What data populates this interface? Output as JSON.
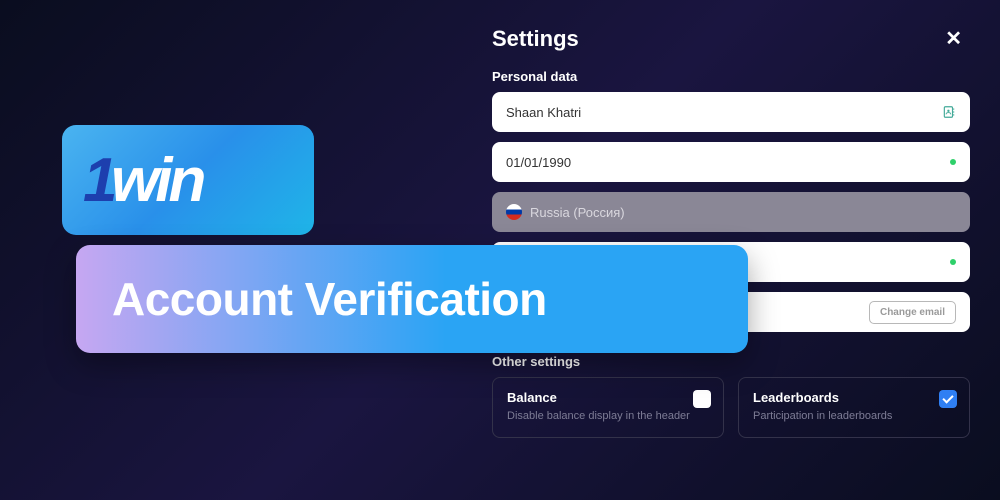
{
  "promo": {
    "logo_text": "1win",
    "title": "Account Verification"
  },
  "settings": {
    "title": "Settings",
    "personal_data_label": "Personal data",
    "name_value": "Shaan Khatri",
    "dob_value": "01/01/1990",
    "country_value": "Russia (Россия)",
    "phone_value": "",
    "email_value": "",
    "change_email_label": "Change email",
    "other_label": "Other settings",
    "balance_card": {
      "title": "Balance",
      "desc": "Disable balance display in the header",
      "checked": false
    },
    "leaderboards_card": {
      "title": "Leaderboards",
      "desc": "Participation in leaderboards",
      "checked": true
    }
  }
}
